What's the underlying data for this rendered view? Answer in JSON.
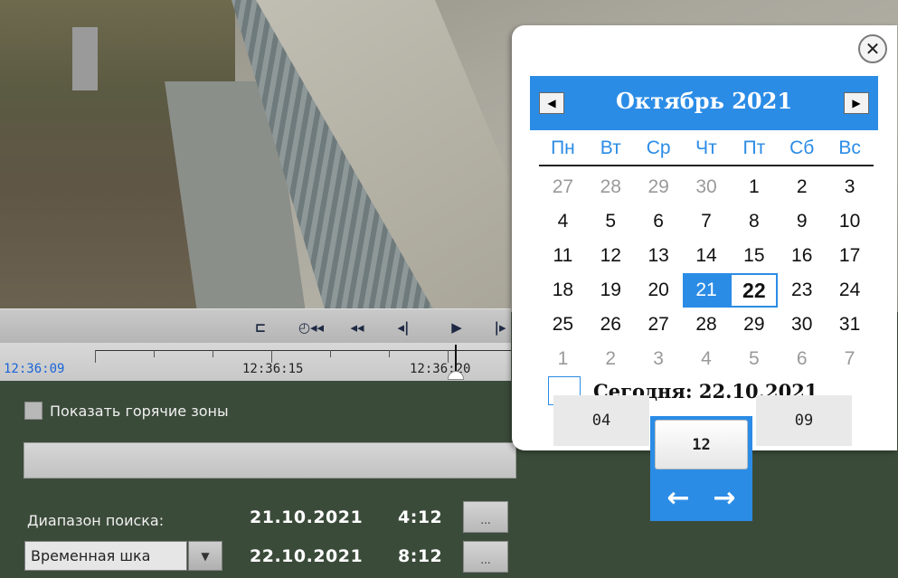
{
  "player": {
    "current_time": "12:36:09",
    "timeline_labels": [
      "12:36:15",
      "12:36:20"
    ]
  },
  "panel": {
    "hot_zones_label": "Показать горячие зоны",
    "range_label": "Диапазон поиска:",
    "from_date": "21.10.2021",
    "from_time": "4:12",
    "to_date": "22.10.2021",
    "to_time": "8:12",
    "dots_label": "...",
    "mode_select_value": "Временная шка"
  },
  "calendar": {
    "month_title": "Октябрь 2021",
    "weekdays": [
      "Пн",
      "Вт",
      "Ср",
      "Чт",
      "Пт",
      "Сб",
      "Вс"
    ],
    "days": [
      "27",
      "28",
      "29",
      "30",
      "1",
      "2",
      "3",
      "4",
      "5",
      "6",
      "7",
      "8",
      "9",
      "10",
      "11",
      "12",
      "13",
      "14",
      "15",
      "16",
      "17",
      "18",
      "19",
      "20",
      "21",
      "22",
      "23",
      "24",
      "25",
      "26",
      "27",
      "28",
      "29",
      "30",
      "31",
      "1",
      "2",
      "3",
      "4",
      "5",
      "6",
      "7"
    ],
    "selected_day": "21",
    "today_day": "22",
    "today_label": "Сегодня: 22.10.2021",
    "accent_color": "#2b8ce6"
  },
  "time_spinner": {
    "prev": "04",
    "current": "12",
    "next": "09"
  },
  "icons": {
    "close": "close-icon",
    "prev_month": "triangle-left-icon",
    "next_month": "triangle-right-icon",
    "arrow_left": "arrow-left-icon",
    "arrow_right": "arrow-right-icon"
  }
}
